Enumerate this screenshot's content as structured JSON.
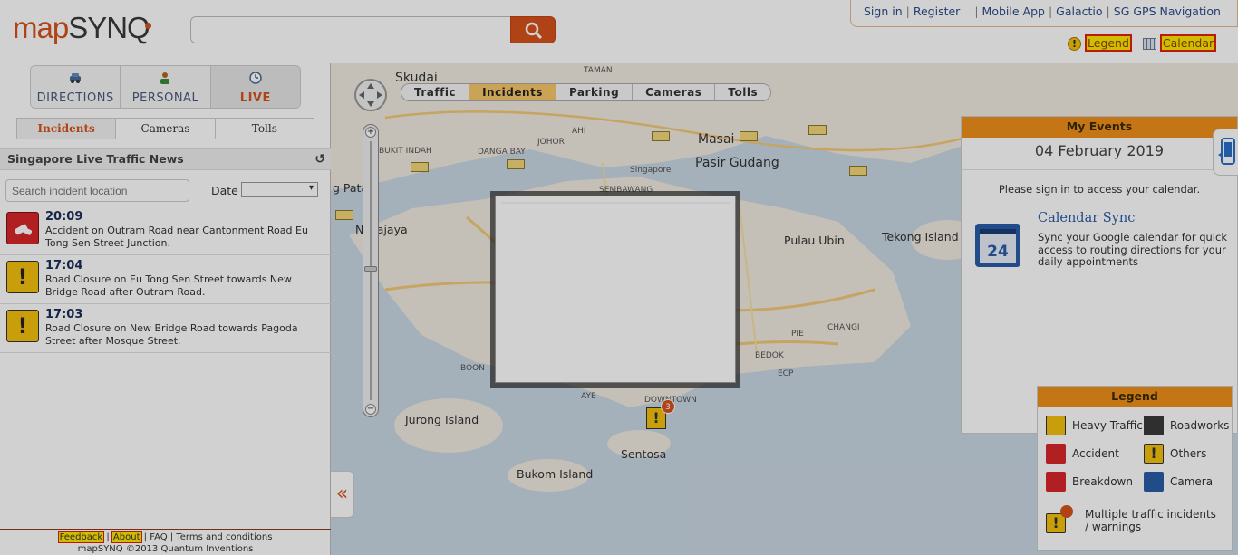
{
  "header": {
    "logo_map": "map",
    "logo_synq": "SYNQ",
    "search": {
      "placeholder": ""
    },
    "links": {
      "sign_in": "Sign in",
      "register": "Register",
      "mobile_app": "Mobile App",
      "galactio": "Galactio",
      "sg_gps": "SG GPS Navigation"
    },
    "legend_link": "Legend",
    "calendar_link": "Calendar"
  },
  "modes": [
    {
      "label": "DIRECTIONS",
      "icon": "car-icon"
    },
    {
      "label": "PERSONAL",
      "icon": "person-icon"
    },
    {
      "label": "LIVE",
      "icon": "clock-icon"
    }
  ],
  "subtabs": [
    "Incidents",
    "Cameras",
    "Tolls"
  ],
  "news": {
    "title": "Singapore Live Traffic News",
    "search_placeholder": "Search incident location",
    "date_label": "Date",
    "date_value": ""
  },
  "incidents": [
    {
      "time": "20:09",
      "type": "accident",
      "desc": "Accident on Outram Road near Cantonment Road Eu Tong Sen Street Junction."
    },
    {
      "time": "17:04",
      "type": "warning",
      "desc": "Road Closure on Eu Tong Sen Street towards New Bridge Road after Outram Road."
    },
    {
      "time": "17:03",
      "type": "warning",
      "desc": "Road Closure on New Bridge Road towards Pagoda Street after Mosque Street."
    }
  ],
  "footer": {
    "feedback": "Feedback",
    "about": "About",
    "faq": "FAQ",
    "terms": "Terms and conditions",
    "copyright": "mapSYNQ ©2013 Quantum Inventions"
  },
  "map": {
    "tabs": [
      "Traffic",
      "Incidents",
      "Parking",
      "Cameras",
      "Tolls"
    ],
    "active_tab": "Incidents",
    "labels": {
      "skudai": "Skudai",
      "taman": "TAMAN",
      "masai": "Masai",
      "pasir_gudang": "Pasir Gudang",
      "bukit_indah": "BUKIT INDAH",
      "danga_bay": "DANGA BAY",
      "johor": "JOHOR",
      "singapore": "Singapore",
      "sembawang": "SEMBAWANG",
      "pulau_ubin": "Pulau Ubin",
      "tekong": "Tekong Island",
      "changi": "CHANGI",
      "bedok": "BEDOK",
      "ecp": "ECP",
      "pie": "PIE",
      "jurong": "Jurong Island",
      "sentosa": "Sentosa",
      "bukom": "Bukom Island",
      "boon": "BOON",
      "ayer": "AYE",
      "downtown": "DOWNTOWN",
      "patah": "g Patah",
      "najaya": "Nusajaya",
      "ahi": "AHI"
    },
    "cluster_count": "3"
  },
  "events": {
    "title": "My Events",
    "date": "04 February 2019",
    "signin_msg": "Please sign in to access your calendar.",
    "sync_title": "Calendar Sync",
    "sync_desc": "Sync your Google calendar for quick access to routing directions for your daily appointments",
    "cal_icon_day": "24"
  },
  "legend": {
    "title": "Legend",
    "items": [
      {
        "label": "Heavy Traffic",
        "icon": "heavy-traffic-icon"
      },
      {
        "label": "Roadworks",
        "icon": "roadworks-icon"
      },
      {
        "label": "Accident",
        "icon": "accident-icon"
      },
      {
        "label": "Others",
        "icon": "others-icon"
      },
      {
        "label": "Breakdown",
        "icon": "breakdown-icon"
      },
      {
        "label": "Camera",
        "icon": "camera-icon"
      },
      {
        "label": "Multiple traffic incidents / warnings",
        "icon": "multiple-incidents-icon"
      }
    ]
  },
  "colors": {
    "brand_orange": "#d6521c",
    "header_orange": "#f0901c",
    "warning_yellow": "#f4c20d",
    "accident_red": "#d8262a",
    "link_blue": "#2b4c8c"
  }
}
